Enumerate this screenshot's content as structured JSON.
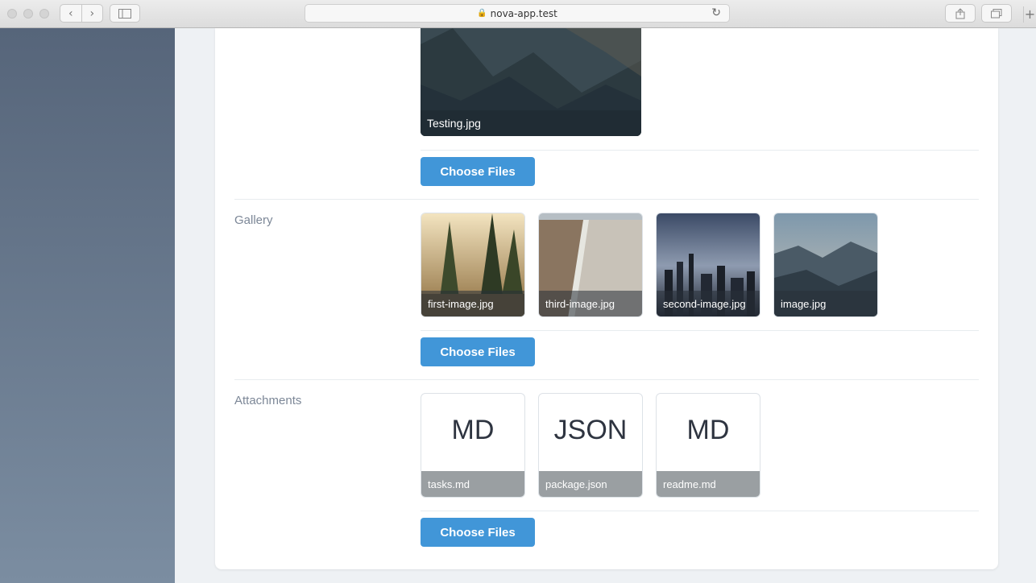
{
  "browser": {
    "url": "nova-app.test"
  },
  "featured_image": {
    "filename": "Testing.jpg",
    "button_label": "Choose Files"
  },
  "gallery": {
    "label": "Gallery",
    "images": [
      {
        "filename": "first-image.jpg"
      },
      {
        "filename": "third-image.jpg"
      },
      {
        "filename": "second-image.jpg"
      },
      {
        "filename": "image.jpg"
      }
    ],
    "button_label": "Choose Files"
  },
  "attachments": {
    "label": "Attachments",
    "files": [
      {
        "type": "MD",
        "filename": "tasks.md"
      },
      {
        "type": "JSON",
        "filename": "package.json"
      },
      {
        "type": "MD",
        "filename": "readme.md"
      }
    ],
    "button_label": "Choose Files"
  },
  "colors": {
    "primary_button": "#4196d8",
    "sidebar": "#56657a",
    "label": "#7c8797"
  }
}
